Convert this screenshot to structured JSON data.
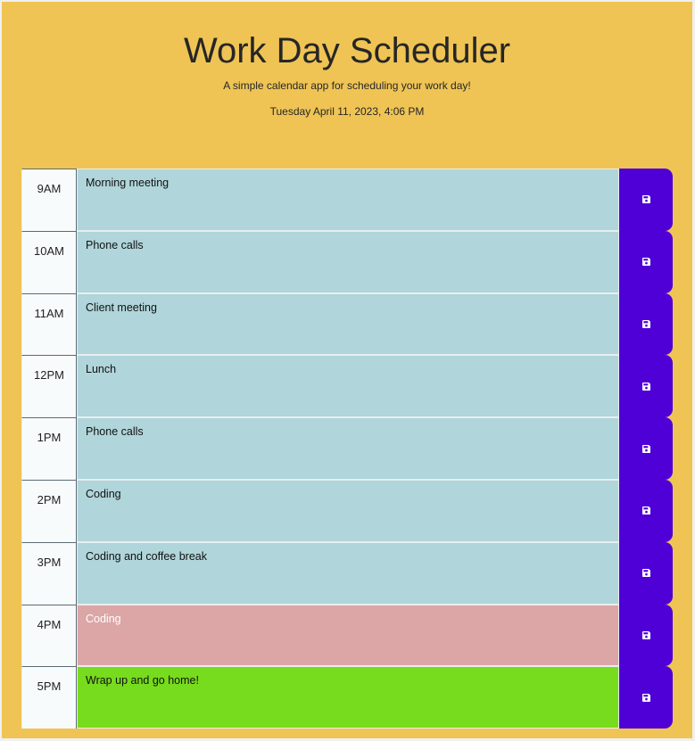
{
  "header": {
    "title": "Work Day Scheduler",
    "subtitle": "A simple calendar app for scheduling your work day!",
    "datetime": "Tuesday April 11, 2023, 4:06 PM"
  },
  "colors": {
    "background": "#efc454",
    "past": "#b0d5da",
    "present": "#dca6a6",
    "future": "#77db1e",
    "save_button": "#4f00d6"
  },
  "save_icon": "floppy-disk-icon",
  "schedule": [
    {
      "hour": "9AM",
      "task": "Morning meeting",
      "state": "past"
    },
    {
      "hour": "10AM",
      "task": "Phone calls",
      "state": "past"
    },
    {
      "hour": "11AM",
      "task": "Client meeting",
      "state": "past"
    },
    {
      "hour": "12PM",
      "task": "Lunch",
      "state": "past"
    },
    {
      "hour": "1PM",
      "task": "Phone calls",
      "state": "past"
    },
    {
      "hour": "2PM",
      "task": "Coding",
      "state": "past"
    },
    {
      "hour": "3PM",
      "task": "Coding and coffee break",
      "state": "past"
    },
    {
      "hour": "4PM",
      "task": "Coding",
      "state": "present"
    },
    {
      "hour": "5PM",
      "task": "Wrap up and go home!",
      "state": "future"
    }
  ]
}
